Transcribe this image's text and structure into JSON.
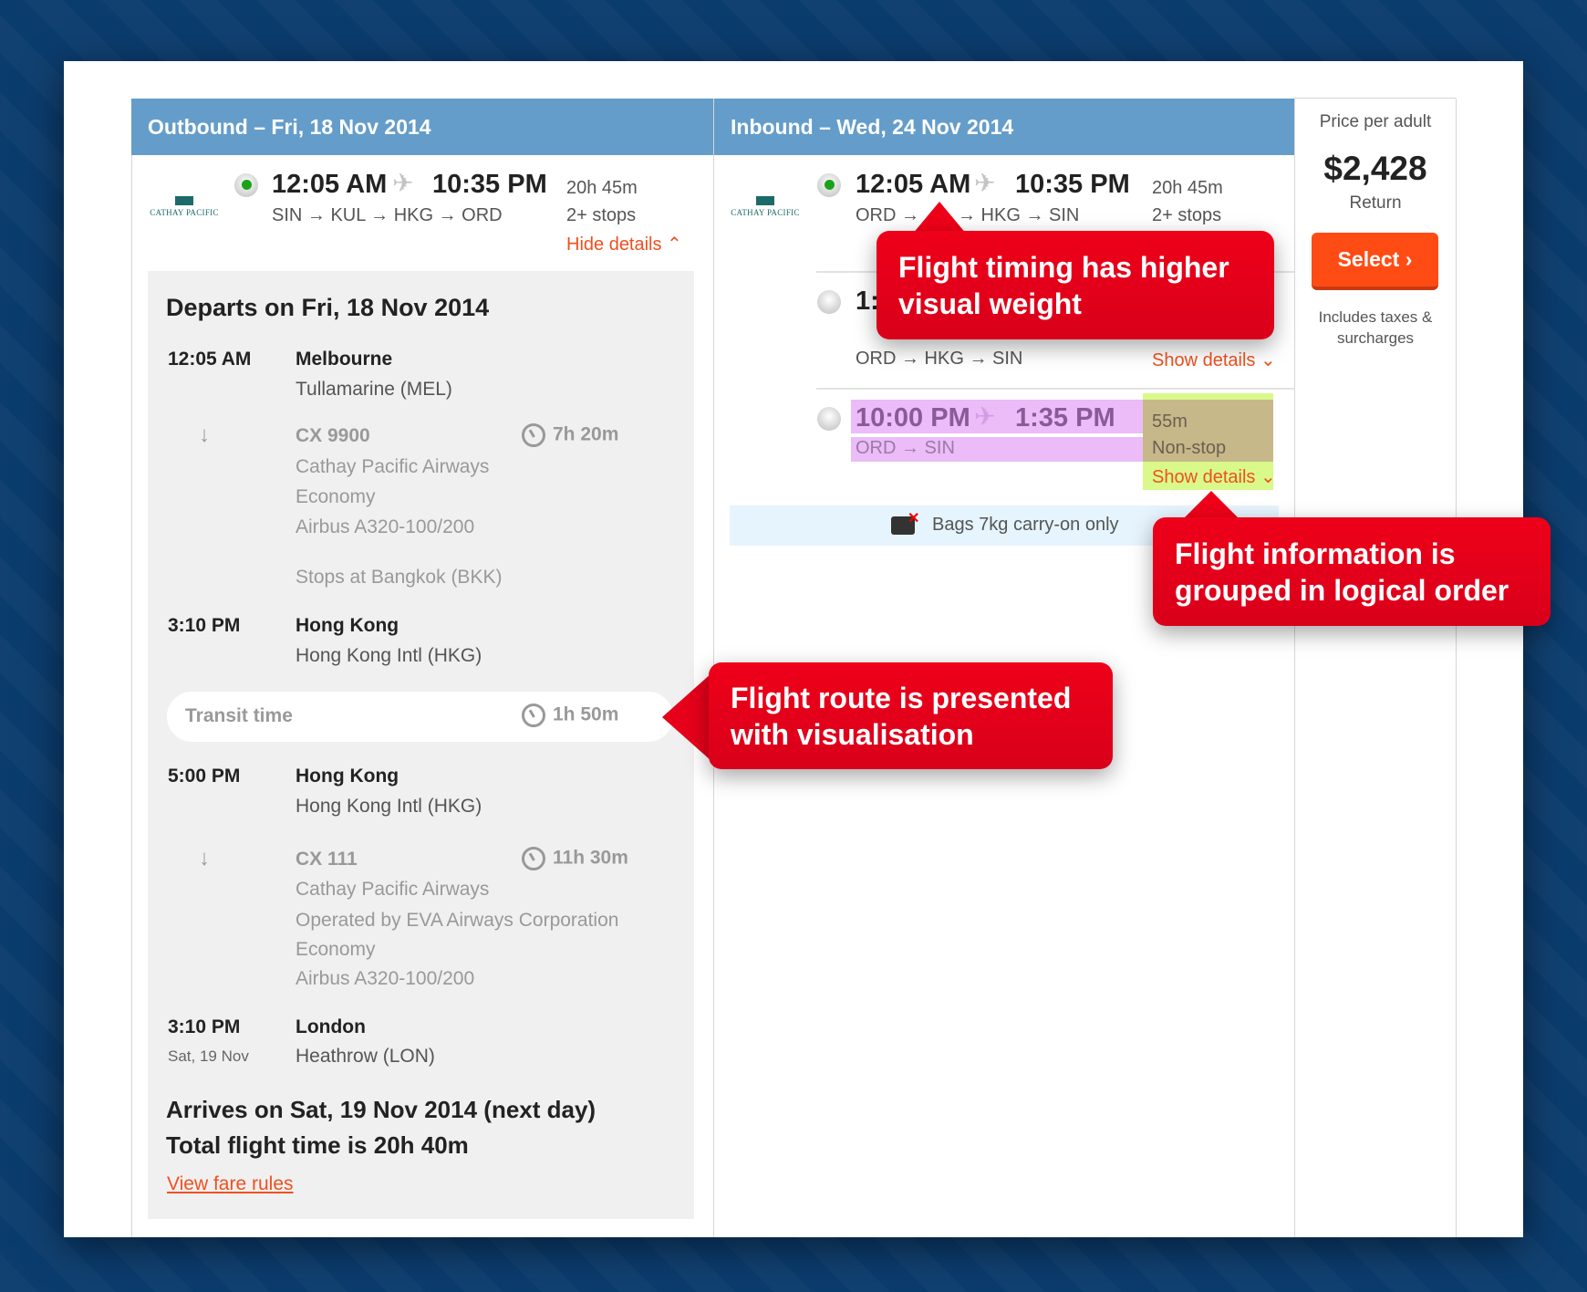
{
  "outbound": {
    "header": "Outbound – Fri, 18 Nov 2014",
    "airline_logo": "Cathay Pacific",
    "depart": "12:05 AM",
    "arrive": "10:35 PM",
    "route": "SIN → KUL → HKG → ORD",
    "duration": "20h 45m",
    "stops": "2+ stops",
    "toggle": "Hide details ⌃",
    "details": {
      "departs_title": "Departs on Fri, 18 Nov 2014",
      "seg1": {
        "dep_time": "12:05 AM",
        "dep_city": "Melbourne",
        "dep_airport": "Tullamarine (MEL)",
        "flight": "CX 9900",
        "airline": "Cathay Pacific Airways",
        "cabin": "Economy",
        "aircraft": "Airbus A320-100/200",
        "stop": "Stops at Bangkok (BKK)",
        "duration": "7h 20m",
        "arr_time": "3:10 PM",
        "arr_city": "Hong Kong",
        "arr_airport": "Hong Kong Intl (HKG)"
      },
      "transit": {
        "label": "Transit time",
        "duration": "1h 50m"
      },
      "seg2": {
        "dep_time": "5:00 PM",
        "dep_city": "Hong Kong",
        "dep_airport": "Hong Kong Intl (HKG)",
        "flight": "CX 111",
        "airline": "Cathay Pacific Airways",
        "operated": "Operated by EVA Airways Corporation",
        "cabin": "Economy",
        "aircraft": "Airbus A320-100/200",
        "duration": "11h 30m",
        "arr_time": "3:10 PM",
        "arr_date": "Sat, 19 Nov",
        "arr_city": "London",
        "arr_airport": "Heathrow (LON)"
      },
      "arrives": "Arrives on Sat, 19 Nov 2014 (next day)",
      "total": "Total flight time is 20h 40m",
      "fare_rules": "View fare rules"
    }
  },
  "inbound": {
    "header": "Inbound – Wed, 24 Nov 2014",
    "airline_logo": "Cathay Pacific",
    "options": [
      {
        "depart": "12:05 AM",
        "arrive": "10:35 PM",
        "route": "ORD → ",
        "route_tail": "→ HKG → SIN",
        "duration": "20h 45m",
        "stops": "2+ stops",
        "selected": true
      },
      {
        "depart": "1:",
        "route": "ORD → HKG → SIN",
        "toggle": "Show details ⌄"
      },
      {
        "depart": "10:00 PM",
        "arrive": "1:35 PM",
        "route": "ORD → SIN",
        "duration": "55m",
        "stops": "Non-stop",
        "toggle": "Show details ⌄"
      }
    ],
    "bags": "Bags 7kg carry-on only"
  },
  "price": {
    "label": "Price per adult",
    "amount": "$2,428",
    "type": "Return",
    "select": "Select",
    "select_icon": "chevron-right",
    "note1": "Includes taxes &",
    "note2": "surcharges"
  },
  "callouts": {
    "timing": [
      "Flight timing has higher",
      "visual weight"
    ],
    "grouped": [
      "Flight information is",
      "grouped in logical order"
    ],
    "route": [
      "Flight route is presented",
      "with visualisation"
    ]
  },
  "colors": {
    "header": "#649dca",
    "accent": "#f0501e",
    "callout": "#e8001c",
    "background": "#0b3c6e"
  }
}
